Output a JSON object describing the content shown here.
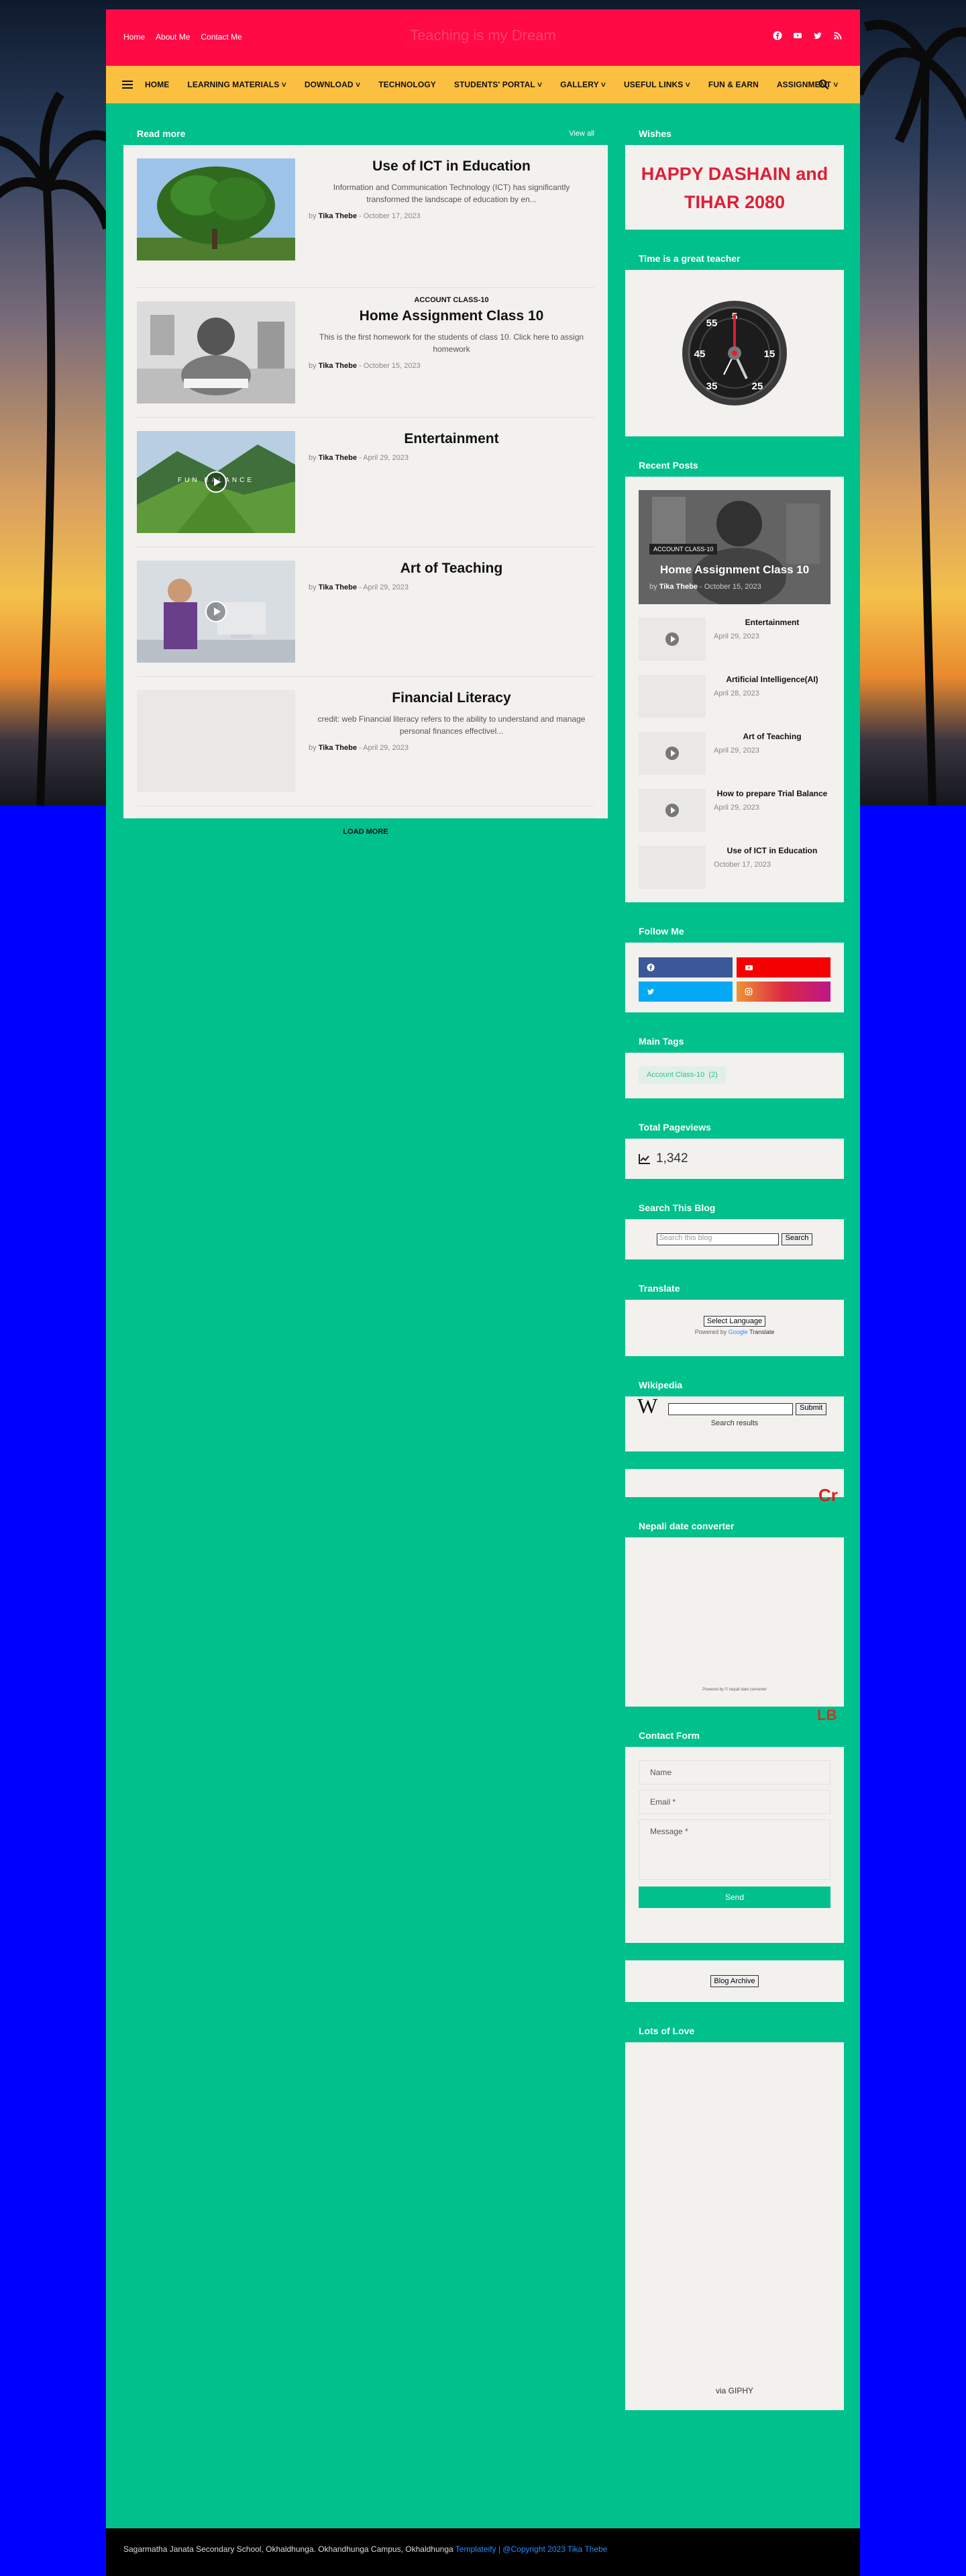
{
  "topbar": {
    "nav": [
      "Home",
      "About Me",
      "Contact Me"
    ],
    "site_title": "Teaching is my Dream",
    "social_icons": [
      "facebook-icon",
      "youtube-icon",
      "twitter-icon",
      "rss-icon"
    ]
  },
  "menu": {
    "items": [
      "HOME",
      "LEARNING MATERIALS ˅",
      "DOWNLOAD ˅",
      "TECHNOLOGY",
      "STUDENTS' PORTAL ˅",
      "GALLERY ˅",
      "USEFUL LINKS ˅",
      "FUN & EARN",
      "ASSIGNMENT ˅"
    ]
  },
  "main": {
    "section_title": "Read more",
    "view_all": "View all",
    "posts": [
      {
        "tag": "",
        "title": "Use of ICT in Education",
        "snippet": "Information and Communication Technology (ICT) has significantly transformed the landscape of education by en...",
        "by": "by",
        "author": "Tika Thebe",
        "date": "- October 17, 2023"
      },
      {
        "tag": "ACCOUNT CLASS-10",
        "title": "Home Assignment Class 10",
        "snippet": "This is the first homework for the students of class 10.  Click here to assign homework",
        "by": "by",
        "author": "Tika Thebe",
        "date": "- October 15, 2023"
      },
      {
        "tag": "",
        "title": "Entertainment",
        "snippet": "",
        "by": "by",
        "author": "Tika Thebe",
        "date": "- April 29, 2023"
      },
      {
        "tag": "",
        "title": "Art of Teaching",
        "snippet": "",
        "by": "by",
        "author": "Tika Thebe",
        "date": "- April 29, 2023"
      },
      {
        "tag": "",
        "title": "Financial Literacy",
        "snippet": "credit: web   Financial literacy refers to the ability to understand and manage personal finances effectivel...",
        "by": "by",
        "author": "Tika Thebe",
        "date": "- April 29, 2023"
      }
    ],
    "thumb3_text": "FUN BALANCE",
    "load_more": "LOAD MORE"
  },
  "sidebar": {
    "wishes_head": "Wishes",
    "wishes_text_1": "HAPPY DASHAIN and",
    "wishes_text_2": "TIHAR 2080",
    "clock_head": "Time is a great teacher",
    "clock_numbers": [
      "55",
      "5",
      "45",
      "15",
      "35",
      "25"
    ],
    "recent_head": "Recent Posts",
    "recent_hero": {
      "badge": "ACCOUNT CLASS-10",
      "title": "Home Assignment Class 10",
      "author": "Tika Thebe",
      "date": "- October 15, 2023"
    },
    "recent_items": [
      {
        "title": "Entertainment",
        "date": "April 29, 2023"
      },
      {
        "title": "Artificial Intelligence(AI)",
        "date": "April 28, 2023"
      },
      {
        "title": "Art of Teaching",
        "date": "April 29, 2023"
      },
      {
        "title": "How to prepare Trial Balance",
        "date": "April 29, 2023"
      },
      {
        "title": "Use of ICT in Education",
        "date": "October 17, 2023"
      }
    ],
    "follow_head": "Follow Me",
    "tags_head": "Main Tags",
    "tag_chip": "Account Class-10",
    "tag_count": "(2)",
    "pageviews_head": "Total Pageviews",
    "pageviews": "1,342",
    "search_head": "Search This Blog",
    "search_placeholder": "Search this blog",
    "search_btn": "Search",
    "translate_head": "Translate",
    "translate_select": "Select Language",
    "translate_powered": "Powered by",
    "translate_google": "Google",
    "translate_word": "Translate",
    "wiki_head": "Wikipedia",
    "wiki_logo": "W",
    "wiki_submit": "Submit",
    "wiki_results": "Search results",
    "cr_text": "Cr",
    "nepali_head": "Nepali date converter",
    "nepali_powered": "Powered by © nepali date converter",
    "lb_text": "LB",
    "contact_head": "Contact Form",
    "contact_name": "Name",
    "contact_email": "Email *",
    "contact_message": "Message *",
    "contact_send": "Send",
    "archive_btn": "Blog Archive",
    "love_head": "Lots of Love",
    "via_giphy": "via GIPHY"
  },
  "footer": {
    "text": "Sagarmatha Janata Secondary School, Okhaldhunga. Okhandhunga Campus, Okhaldhunga",
    "templateify": "Templateify",
    "copyright": "| @Copyright 2023 Tika Thebe"
  },
  "colors": {
    "topbar": "#ff0a45",
    "menu": "#fcc041",
    "content": "#00c08b",
    "page": "#0000ff",
    "wishes": "#e11d35"
  }
}
